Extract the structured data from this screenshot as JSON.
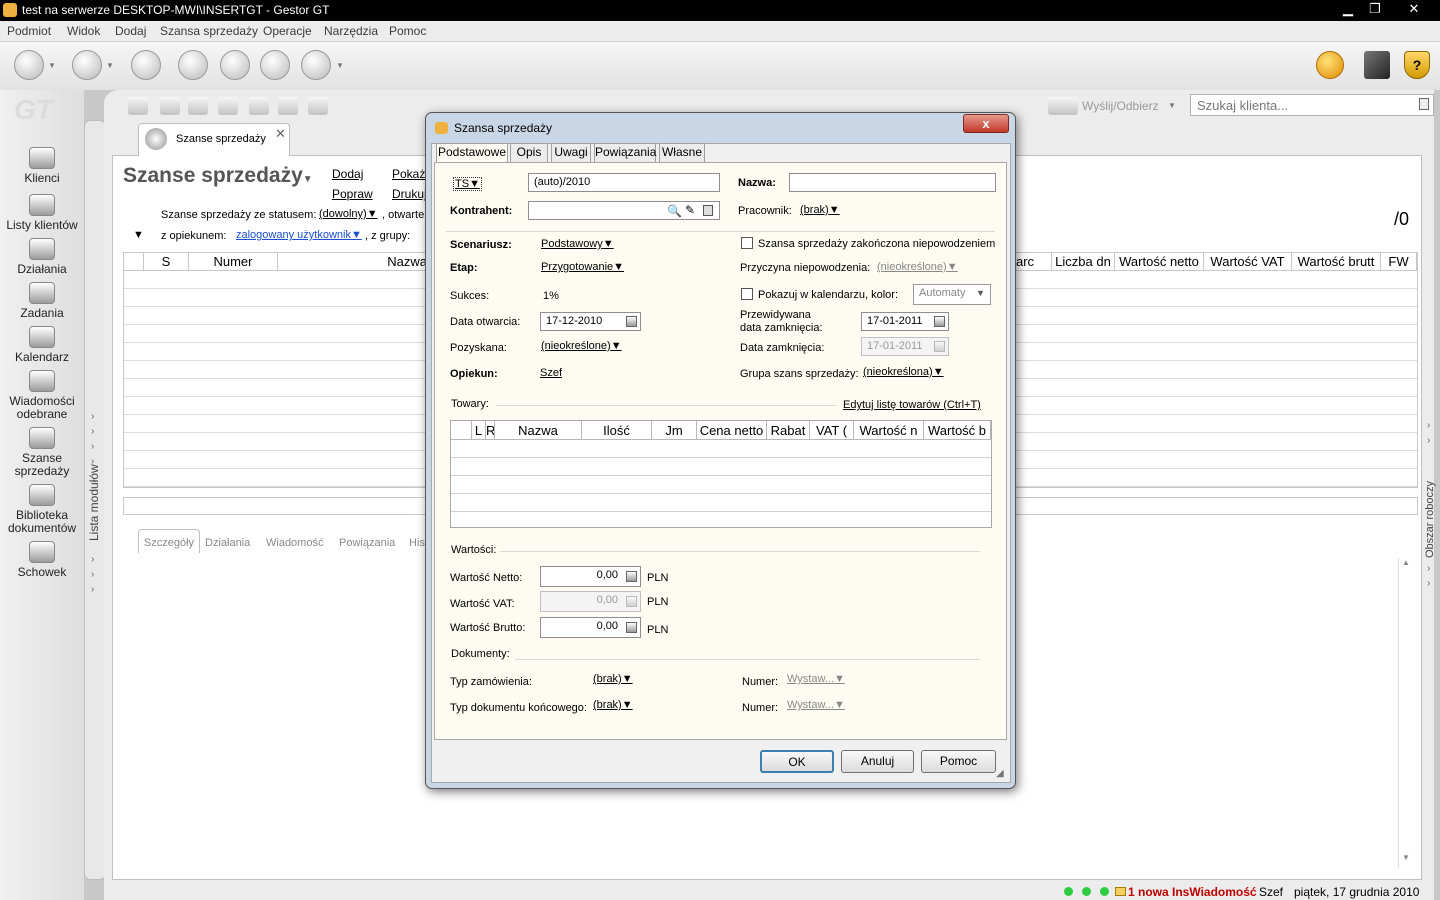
{
  "window": {
    "title": "test na serwerze DESKTOP-MWI\\INSERTGT - Gestor GT"
  },
  "menu": [
    "Podmiot",
    "Widok",
    "Dodaj",
    "Szansa sprzedaży",
    "Operacje",
    "Narzędzia",
    "Pomoc"
  ],
  "sidebar": {
    "items": [
      {
        "label": "Klienci"
      },
      {
        "label": "Listy klientów"
      },
      {
        "label": "Działania"
      },
      {
        "label": "Zadania"
      },
      {
        "label": "Kalendarz"
      },
      {
        "label": "Wiadomości odebrane"
      },
      {
        "label": "Szanse sprzedaży"
      },
      {
        "label": "Biblioteka dokumentów"
      },
      {
        "label": "Schowek"
      }
    ],
    "strip_label": "Lista modułów"
  },
  "right_strip_label": "Obszar roboczy",
  "main": {
    "send_receive": "Wyślij/Odbierz",
    "search_placeholder": "Szukaj klienta...",
    "doc_tab": "Szanse sprzedaży",
    "title": "Szanse sprzedaży",
    "actions": {
      "add": "Dodaj",
      "edit": "Popraw",
      "show": "Pokaż",
      "print": "Drukuj"
    },
    "filter": {
      "status_prefix": "Szanse sprzedaży ze statusem:",
      "status_value": "(dowolny)",
      "status_suffix": ", otwarte",
      "owner_prefix": "z opiekunem:",
      "owner_value": "zalogowany użytkownik",
      "group_prefix": ", z grupy:"
    },
    "count": "/0",
    "grid_headers_left": [
      "S",
      "Numer",
      "Nazwa"
    ],
    "grid_headers_right": [
      "arc",
      "Liczba dn",
      "Wartość netto",
      "Wartość VAT",
      "Wartość brutt",
      "FW"
    ],
    "bottom_tabs": [
      "Szczegóły",
      "Działania",
      "Wiadomość",
      "Powiązania",
      "His"
    ]
  },
  "statusbar": {
    "messages": "1 nowa InsWiadomość",
    "user": "Szef",
    "date": "piątek, 17 grudnia 2010"
  },
  "dialog": {
    "title": "Szansa sprzedaży",
    "close": "x",
    "tabs": [
      "Podstawowe",
      "Opis",
      "Uwagi",
      "Powiązania",
      "Własne"
    ],
    "ts": "TS",
    "number": "(auto)/2010",
    "name_label": "Nazwa:",
    "name_value": "",
    "contractor_label": "Kontrahent:",
    "employee_label": "Pracownik:",
    "employee_value": "(brak)",
    "scenario_label": "Scenariusz:",
    "scenario_value": "Podstawowy",
    "failed_label": "Szansa sprzedaży zakończona niepowodzeniem",
    "stage_label": "Etap:",
    "stage_value": "Przygotowanie",
    "failure_reason_label": "Przyczyna niepowodzenia:",
    "failure_reason_value": "(nieokreślone)",
    "success_label": "Sukces:",
    "success_value": "1%",
    "calendar_label": "Pokazuj w kalendarzu, kolor:",
    "calendar_color": "Automaty",
    "open_date_label": "Data otwarcia:",
    "open_date": "17-12-2010",
    "expected_close_label1": "Przewidywana",
    "expected_close_label2": "data zamknięcia:",
    "expected_close": "17-01-2011",
    "acquired_label": "Pozyskana:",
    "acquired_value": "(nieokreślone)",
    "close_date_label": "Data zamknięcia:",
    "close_date": "17-01-2011",
    "owner_label": "Opiekun:",
    "owner_value": "Szef",
    "group_label": "Grupa szans sprzedaży:",
    "group_value": "(nieokreślona)",
    "goods_label": "Towary:",
    "edit_goods": "Edytuj listę towarów   (Ctrl+T)",
    "goods_headers": [
      "L",
      "R",
      "Nazwa",
      "Ilość",
      "Jm",
      "Cena netto",
      "Rabat",
      "VAT (",
      "Wartość n",
      "Wartość b"
    ],
    "values_label": "Wartości:",
    "net_label": "Wartość Netto:",
    "net_value": "0,00",
    "vat_label": "Wartość VAT:",
    "vat_value": "0,00",
    "gross_label": "Wartość Brutto:",
    "gross_value": "0,00",
    "currency": "PLN",
    "documents_label": "Dokumenty:",
    "order_type_label": "Typ zamówienia:",
    "order_type_value": "(brak)",
    "final_doc_label": "Typ dokumentu końcowego:",
    "final_doc_value": "(brak)",
    "number_label": "Numer:",
    "number_value": "Wystaw...",
    "ok": "OK",
    "cancel": "Anuluj",
    "help": "Pomoc"
  }
}
